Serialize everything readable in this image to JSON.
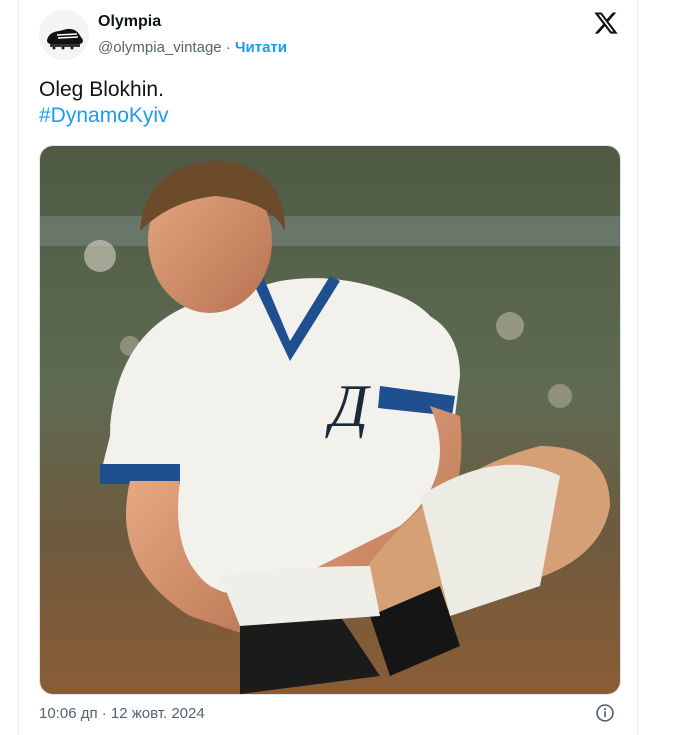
{
  "tweet": {
    "author_name": "Olympia",
    "author_handle": "@olympia_vintage",
    "separator": "·",
    "follow_label": "Читати",
    "text_line1": "Oleg Blokhin.",
    "hashtag": "#DynamoKyiv",
    "timestamp": "10:06 дп · 12 жовт. 2024"
  },
  "icons": {
    "platform": "x-logo-icon",
    "info": "info-icon",
    "avatar": "football-boot-avatar"
  },
  "colors": {
    "link": "#1d9bf0",
    "muted": "#536471",
    "jersey_trim": "#1f4f8f"
  }
}
